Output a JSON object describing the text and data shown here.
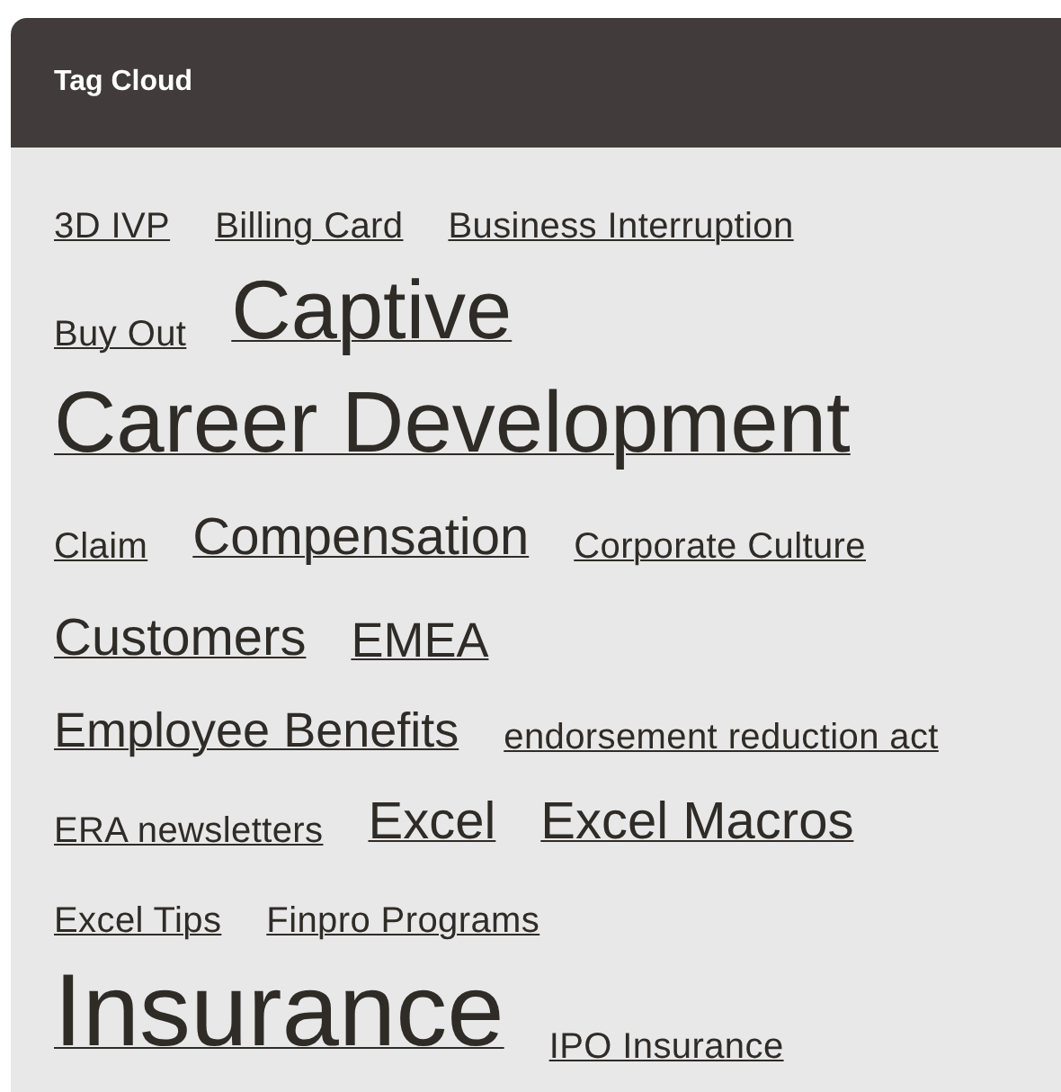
{
  "title": "Tag Cloud",
  "lines": [
    [
      {
        "label": "3D IVP",
        "kind": "small"
      },
      {
        "label": "Billing Card",
        "kind": "small"
      },
      {
        "label": "Business Interruption",
        "kind": "small"
      }
    ],
    [
      {
        "label": "Buy Out",
        "kind": "small"
      },
      {
        "label": "Captive",
        "kind": "xlarge"
      }
    ],
    [
      {
        "label": "Career Development",
        "kind": "xxlarge"
      }
    ],
    [
      {
        "label": "Claim",
        "kind": "small"
      },
      {
        "label": "Compensation",
        "kind": "large"
      },
      {
        "label": "Corporate Culture",
        "kind": "small"
      }
    ],
    [
      {
        "label": "Customers",
        "kind": "large"
      },
      {
        "label": "EMEA",
        "kind": "medium"
      }
    ],
    [
      {
        "label": "Employee Benefits",
        "kind": "medium"
      },
      {
        "label": "endorsement reduction act",
        "kind": "small"
      }
    ],
    [
      {
        "label": "ERA newsletters",
        "kind": "small"
      },
      {
        "label": "Excel",
        "kind": "large"
      },
      {
        "label": "Excel Macros",
        "kind": "large"
      }
    ],
    [
      {
        "label": "Excel Tips",
        "kind": "small"
      },
      {
        "label": "Finpro Programs",
        "kind": "small"
      }
    ],
    [
      {
        "label": "Insurance",
        "kind": "huge"
      },
      {
        "label": "IPO Insurance",
        "kind": "small"
      }
    ]
  ]
}
